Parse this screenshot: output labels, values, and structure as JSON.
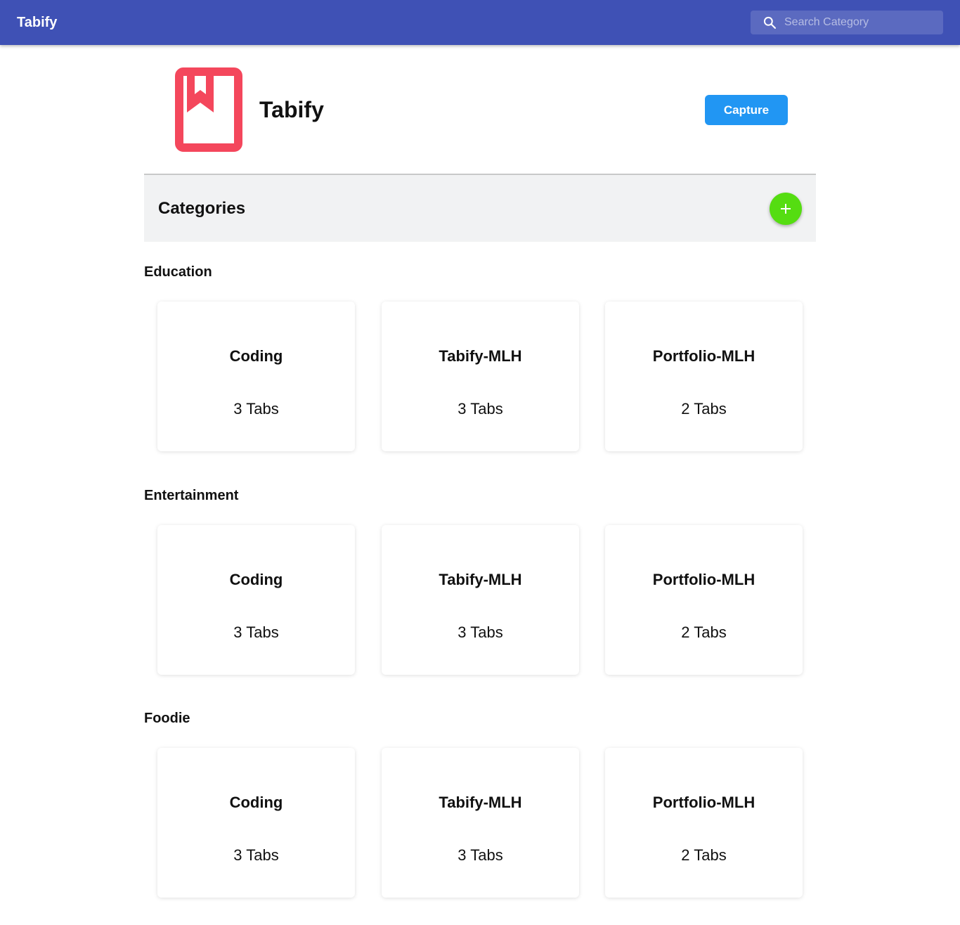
{
  "appbar": {
    "title": "Tabify",
    "search_placeholder": "Search Category",
    "color": "#3f51b5"
  },
  "header": {
    "brand": "Tabify",
    "capture_label": "Capture",
    "logo_icon": "bookmark-icon",
    "logo_color": "#f4475c"
  },
  "categories": {
    "title": "Categories",
    "add_icon": "plus-icon",
    "add_color": "#55dd11"
  },
  "sections": [
    {
      "title": "Education",
      "cards": [
        {
          "name": "Coding",
          "count": "3 Tabs"
        },
        {
          "name": "Tabify-MLH",
          "count": "3 Tabs"
        },
        {
          "name": "Portfolio-MLH",
          "count": "2 Tabs"
        }
      ]
    },
    {
      "title": "Entertainment",
      "cards": [
        {
          "name": "Coding",
          "count": "3 Tabs"
        },
        {
          "name": "Tabify-MLH",
          "count": "3 Tabs"
        },
        {
          "name": "Portfolio-MLH",
          "count": "2 Tabs"
        }
      ]
    },
    {
      "title": "Foodie",
      "cards": [
        {
          "name": "Coding",
          "count": "3 Tabs"
        },
        {
          "name": "Tabify-MLH",
          "count": "3 Tabs"
        },
        {
          "name": "Portfolio-MLH",
          "count": "2 Tabs"
        }
      ]
    }
  ]
}
